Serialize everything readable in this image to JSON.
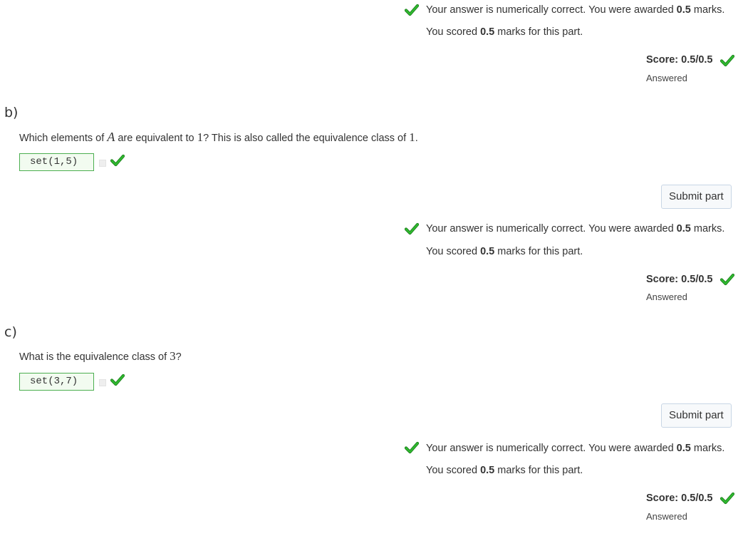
{
  "colors": {
    "tick": "#2fb82f",
    "answer_border": "#4caf50",
    "button_border": "#c8d6e5"
  },
  "part_a": {
    "feedback_pre": "Your answer is numerically correct. You were awarded ",
    "feedback_marks": "0.5",
    "feedback_post": " marks.",
    "scored_pre": "You scored ",
    "scored_marks": "0.5",
    "scored_post": " marks for this part.",
    "score": "Score: 0.5/0.5",
    "status": "Answered"
  },
  "part_b": {
    "label": "b)",
    "prompt_1": "Which elements of ",
    "prompt_var": "A",
    "prompt_2": " are equivalent to ",
    "prompt_num": "1",
    "prompt_3": "? This is also called the equivalence class of ",
    "prompt_num2": "1",
    "prompt_4": ".",
    "answer": "set(1,5)",
    "submit_label": "Submit part",
    "feedback_pre": "Your answer is numerically correct. You were awarded ",
    "feedback_marks": "0.5",
    "feedback_post": " marks.",
    "scored_pre": "You scored ",
    "scored_marks": "0.5",
    "scored_post": " marks for this part.",
    "score": "Score: 0.5/0.5",
    "status": "Answered"
  },
  "part_c": {
    "label": "c)",
    "prompt_1": "What is the equivalence class of ",
    "prompt_num": "3",
    "prompt_2": "?",
    "answer": "set(3,7)",
    "submit_label": "Submit part",
    "feedback_pre": "Your answer is numerically correct. You were awarded ",
    "feedback_marks": "0.5",
    "feedback_post": " marks.",
    "scored_pre": "You scored ",
    "scored_marks": "0.5",
    "scored_post": " marks for this part.",
    "score": "Score: 0.5/0.5",
    "status": "Answered"
  }
}
